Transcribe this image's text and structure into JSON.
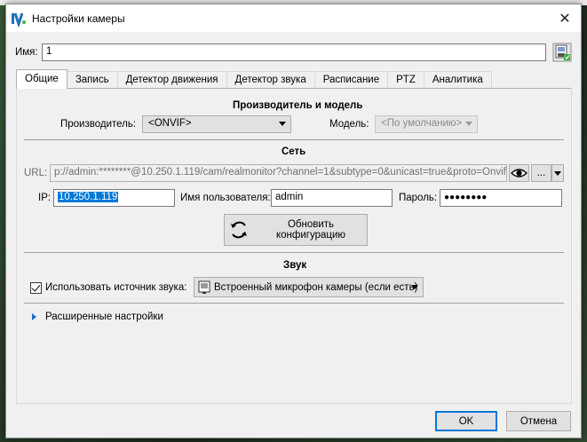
{
  "window": {
    "title": "Настройки камеры",
    "close_glyph": "✕"
  },
  "name_field": {
    "label": "Имя:",
    "value": "1"
  },
  "tabs": [
    {
      "label": "Общие",
      "active": true
    },
    {
      "label": "Запись"
    },
    {
      "label": "Детектор движения"
    },
    {
      "label": "Детектор звука"
    },
    {
      "label": "Расписание"
    },
    {
      "label": "PTZ"
    },
    {
      "label": "Аналитика"
    }
  ],
  "manufacturer_section": {
    "title": "Производитель и модель",
    "manufacturer_label": "Производитель:",
    "manufacturer_value": "<ONVIF>",
    "model_label": "Модель:",
    "model_value": "<По умолчанию>"
  },
  "network_section": {
    "title": "Сеть",
    "url_label": "URL:",
    "url_value": "p://admin:********@10.250.1.119/cam/realmonitor?channel=1&subtype=0&unicast=true&proto=Onvif",
    "more_button": "...",
    "ip_label": "IP:",
    "ip_value": "10.250.1.119",
    "user_label": "Имя пользователя:",
    "user_value": "admin",
    "password_label": "Пароль:",
    "password_value": "●●●●●●●●",
    "refresh_button": "Обновить конфигурацию"
  },
  "sound_section": {
    "title": "Звук",
    "use_audio_label": "Использовать источник звука:",
    "use_audio_checked": true,
    "audio_source_value": "Встроенный микрофон камеры (если есть)"
  },
  "advanced": {
    "label": "Расширенные настройки"
  },
  "footer": {
    "ok_label": "OK",
    "cancel_label": "Отмена"
  },
  "icons": {
    "app": "app-logo-icon",
    "save": "save-icon",
    "eye": "eye-icon",
    "refresh": "refresh-icon",
    "microphone": "microphone-icon",
    "expand": "triangle-right-icon"
  },
  "colors": {
    "accent": "#0078d7",
    "dialog_bg": "#f0f0f0"
  }
}
